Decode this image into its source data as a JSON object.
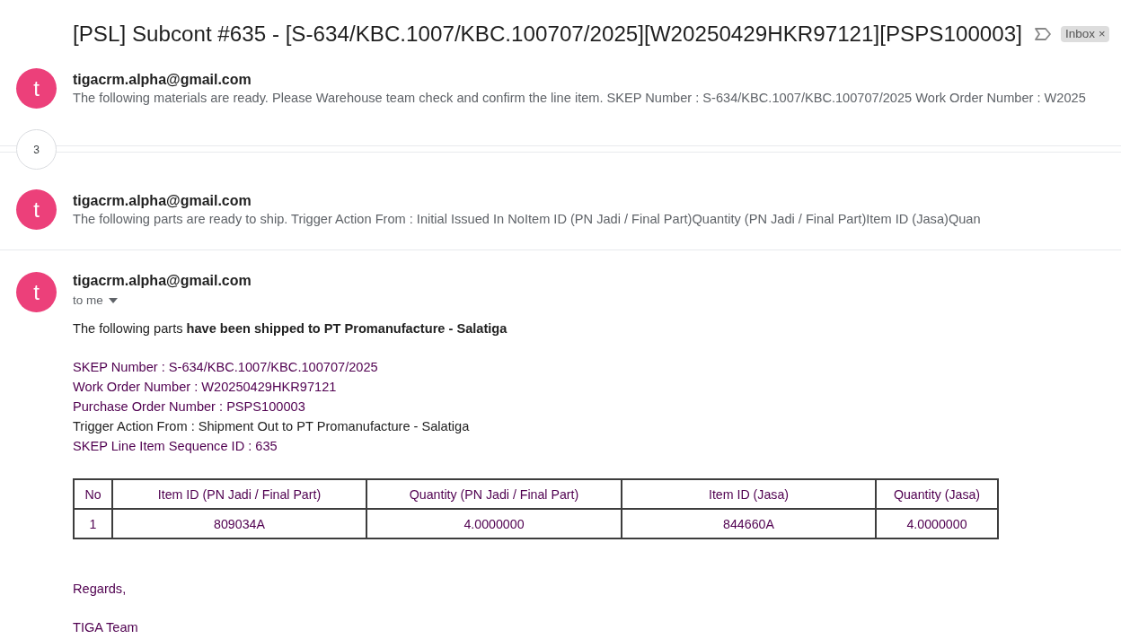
{
  "subject": "[PSL] Subcont #635 - [S-634/KBC.1007/KBC.100707/2025][W20250429HKR97121][PSPS100003]",
  "important": false,
  "labels": [
    {
      "text": "Inbox",
      "remove": "×"
    }
  ],
  "thread": [
    {
      "kind": "collapsed",
      "avatar": "t",
      "sender": "tigacrm.alpha@gmail.com",
      "snippet": "The following materials are ready. Please Warehouse team check and confirm the line item. SKEP Number : S-634/KBC.1007/KBC.100707/2025 Work Order Number : W2025"
    },
    {
      "kind": "hidden_count",
      "count": "3"
    },
    {
      "kind": "collapsed",
      "avatar": "t",
      "sender": "tigacrm.alpha@gmail.com",
      "snippet": "The following parts are ready to ship. Trigger Action From : Initial Issued In NoItem ID (PN Jadi / Final Part)Quantity (PN Jadi / Final Part)Item ID (Jasa)Quan"
    },
    {
      "kind": "expanded",
      "avatar": "t",
      "sender": "tigacrm.alpha@gmail.com",
      "recipient": "to me",
      "body": {
        "intro": "The following parts **have been shipped to PT Promanufacture - Salatiga**",
        "details": [
          {
            "text": "SKEP Number : S-634/KBC.1007/KBC.100707/2025",
            "color": "#500050"
          },
          {
            "text": "Work Order Number : W20250429HKR97121",
            "color": "#500050"
          },
          {
            "text": "Purchase Order Number : PSPS100003",
            "color": "#500050"
          },
          {
            "text": "Trigger Action From : Shipment Out to PT Promanufacture - Salatiga",
            "color": "#222222"
          },
          {
            "text": "SKEP Line Item Sequence ID : 635",
            "color": "#500050"
          }
        ],
        "table": {
          "columns": [
            "No",
            "Item ID (PN Jadi / Final Part)",
            "Quantity (PN Jadi / Final Part)",
            "Item ID (Jasa)",
            "Quantity (Jasa)"
          ],
          "rows": [
            [
              "1",
              "809034A",
              "4.0000000",
              "844660A",
              "4.0000000"
            ]
          ]
        },
        "closing": [
          "Regards,",
          "TIGA Team"
        ]
      }
    }
  ]
}
